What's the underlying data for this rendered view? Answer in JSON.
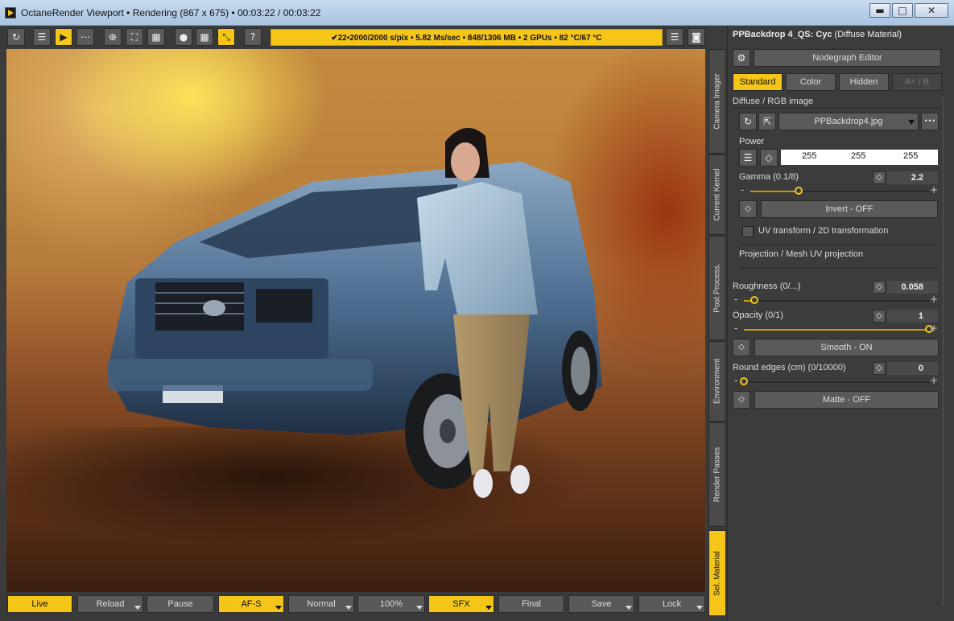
{
  "window": {
    "title": "OctaneRender Viewport • Rendering (867 x 675) • 00:03:22 / 00:03:22",
    "minimize": "▬",
    "maximize": "□",
    "close": "✕"
  },
  "toolbar": {
    "icons": [
      {
        "name": "refresh-icon",
        "glyph": "↻"
      },
      {
        "name": "list-icon",
        "glyph": "☰"
      },
      {
        "name": "play-icon",
        "glyph": "▶"
      },
      {
        "name": "share-icon",
        "glyph": "⋯"
      },
      {
        "name": "target-icon",
        "glyph": "⊕"
      },
      {
        "name": "focus-icon",
        "glyph": "⛶"
      },
      {
        "name": "grid-icon",
        "glyph": "▦"
      },
      {
        "name": "record-icon",
        "glyph": "●"
      },
      {
        "name": "table-icon",
        "glyph": "▦"
      },
      {
        "name": "resize-icon",
        "glyph": "⤡"
      },
      {
        "name": "help-icon",
        "glyph": "?"
      }
    ],
    "status": "✔22•2000/2000 s/pix • 5.82 Ms/sec • 848/1306 MB • 2 GPUs • 82 °C/67 °C",
    "right_icons": [
      {
        "name": "menu-icon",
        "glyph": "☰"
      },
      {
        "name": "camera-icon",
        "glyph": "◙"
      }
    ]
  },
  "bottombar": {
    "buttons": [
      {
        "label": "Live",
        "active": true,
        "arrow": false
      },
      {
        "label": "Reload",
        "active": false,
        "arrow": true
      },
      {
        "label": "Pause",
        "active": false,
        "arrow": false
      },
      {
        "label": "AF-S",
        "active": true,
        "arrow": true
      },
      {
        "label": "Normal",
        "active": false,
        "arrow": true
      },
      {
        "label": "100%",
        "active": false,
        "arrow": true
      },
      {
        "label": "SFX",
        "active": true,
        "arrow": true
      },
      {
        "label": "Final",
        "active": false,
        "arrow": false
      },
      {
        "label": "Save",
        "active": false,
        "arrow": true
      },
      {
        "label": "Lock",
        "active": false,
        "arrow": true
      }
    ]
  },
  "vtabs": [
    {
      "label": "Camera Imager",
      "active": false
    },
    {
      "label": "Current Kernel",
      "active": false
    },
    {
      "label": "Post Process.",
      "active": false
    },
    {
      "label": "Environment",
      "active": false
    },
    {
      "label": "Render Passes",
      "active": false
    },
    {
      "label": "Sel. Material",
      "active": true
    }
  ],
  "panel": {
    "title_bold": "PPBackdrop 4_QS: Cyc",
    "title_rest": " (Diffuse Material)",
    "settings_icon": "⚙",
    "nodegraph_button": "Nodegraph Editor",
    "tabs": [
      {
        "label": "Standard",
        "state": "active"
      },
      {
        "label": "Color",
        "state": "normal"
      },
      {
        "label": "Hidden",
        "state": "normal"
      },
      {
        "label": "A< / B",
        "state": "disabled"
      }
    ],
    "diffuse_header": "Diffuse / RGB image",
    "refresh_icon": "↻",
    "external_icon": "⇱",
    "image_file": "PPBackdrop4.jpg",
    "more_icon": "•••",
    "power_label": "Power",
    "power_list_icon": "☰",
    "diamond": "◇",
    "rgb": [
      "255",
      "255",
      "255"
    ],
    "gamma_label": "Gamma (0.1/8)",
    "gamma_value": "2.2",
    "gamma_fraction": 0.27,
    "invert_button": "Invert - OFF",
    "uv_transform_label": "UV transform / 2D transformation",
    "projection_label": "Projection / Mesh UV projection",
    "roughness_label": "Roughness (0/...)",
    "roughness_value": "0.058",
    "roughness_fraction": 0.058,
    "opacity_label": "Opacity (0/1)",
    "opacity_value": "1",
    "opacity_fraction": 1.0,
    "smooth_button": "Smooth - ON",
    "round_edges_label": "Round edges (cm) (0/10000)",
    "round_edges_value": "0",
    "round_edges_fraction": 0.0,
    "matte_button": "Matte - OFF",
    "minus": "-",
    "plus": "+"
  },
  "colors": {
    "accent": "#f5c518",
    "panel_bg": "#3c3c3c",
    "button_bg": "#5a5a5a"
  }
}
